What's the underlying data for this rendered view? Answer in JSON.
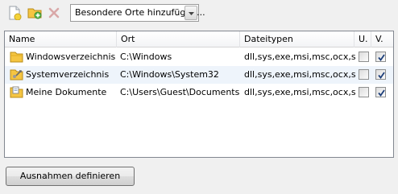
{
  "toolbar": {
    "new_icon": "new-document-icon",
    "add_icon": "add-folder-icon",
    "delete_icon": "delete-icon",
    "dropdown_value": "Besondere Orte hinzufügen..."
  },
  "list": {
    "columns": [
      "Name",
      "Ort",
      "Dateitypen",
      "U.",
      "V."
    ],
    "rows": [
      {
        "name": "Windowsverzeichnis",
        "icon": "folder-icon",
        "ort": "C:\\Windows",
        "typen": "dll,sys,exe,msi,msc,ocx,s...",
        "u": false,
        "v": true
      },
      {
        "name": "Systemverzeichnis",
        "icon": "system-folder-icon",
        "ort": "C:\\Windows\\System32",
        "typen": "dll,sys,exe,msi,msc,ocx,s...",
        "u": false,
        "v": true
      },
      {
        "name": "Meine Dokumente",
        "icon": "documents-folder-icon",
        "ort": "C:\\Users\\Guest\\Documents",
        "typen": "dll,sys,exe,msi,msc,ocx,s...",
        "u": false,
        "v": true
      }
    ]
  },
  "footer": {
    "define_button": "Ausnahmen definieren"
  },
  "colors": {
    "accent": "#3a6ea5",
    "folder": "#f5c542",
    "delete_disabled": "#d9a8a8"
  }
}
